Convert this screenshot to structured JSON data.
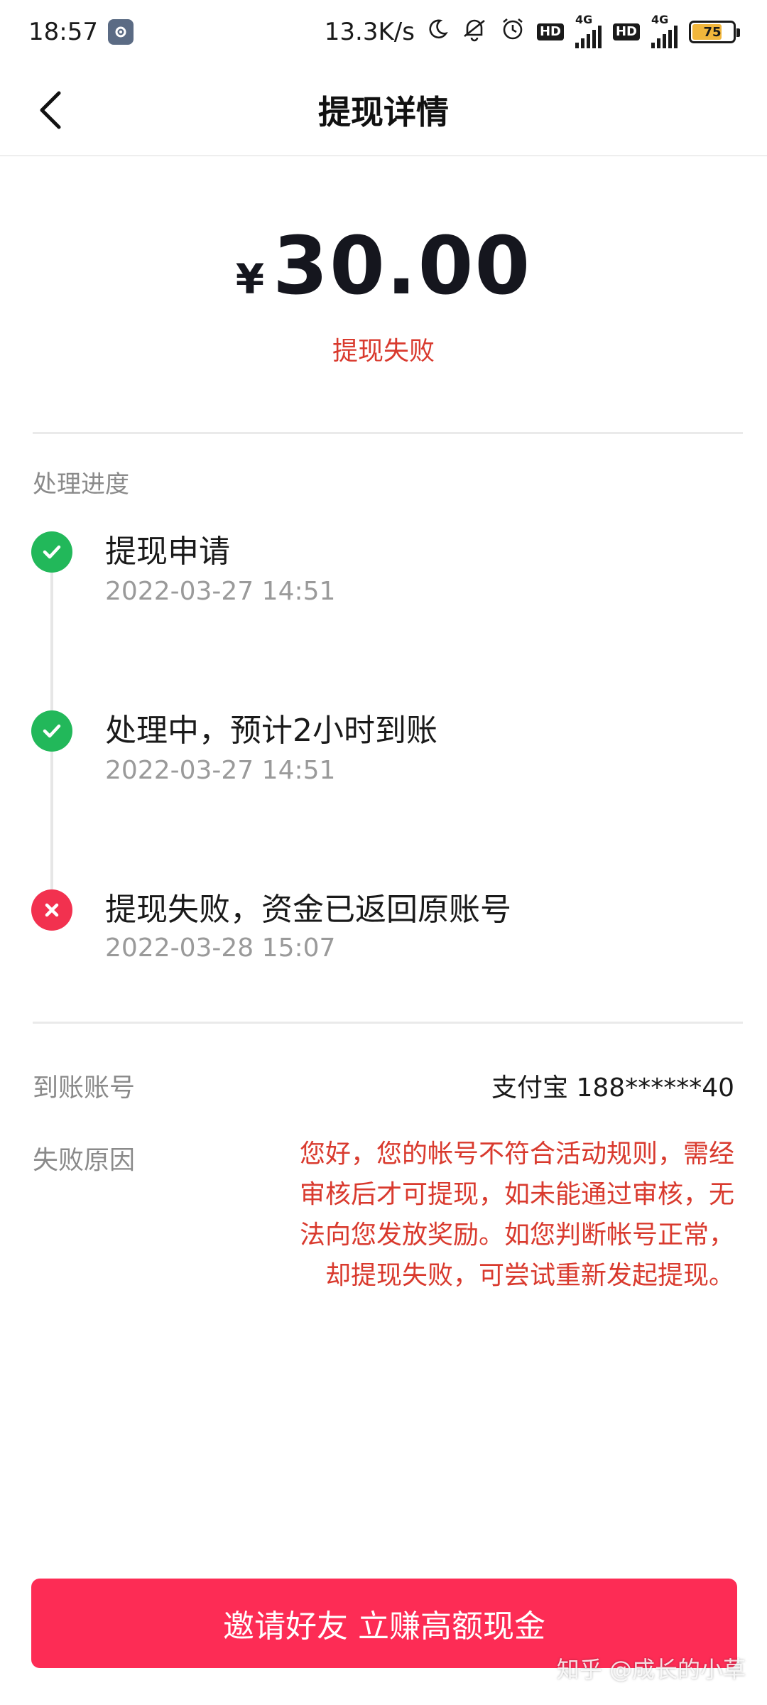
{
  "status_bar": {
    "time": "18:57",
    "net_speed": "13.3K/s",
    "network_label_1": "4G",
    "network_label_2": "4G",
    "hd_label_1": "HD",
    "hd_label_2": "HD",
    "battery": "75",
    "battery_level": 0.75
  },
  "nav": {
    "title": "提现详情"
  },
  "amount": {
    "symbol": "¥",
    "value": "30.00"
  },
  "status_text": "提现失败",
  "progress": {
    "label": "处理进度",
    "steps": [
      {
        "title": "提现申请",
        "time": "2022-03-27 14:51",
        "state": "done"
      },
      {
        "title": "处理中，预计2小时到账",
        "time": "2022-03-27 14:51",
        "state": "done"
      },
      {
        "title": "提现失败，资金已返回原账号",
        "time": "2022-03-28 15:07",
        "state": "failed"
      }
    ]
  },
  "account": {
    "label": "到账账号",
    "value": "支付宝 188******40"
  },
  "reason": {
    "label": "失败原因",
    "lines": [
      "您好，您的帐号不符合活动规则，需经",
      "审核后才可提现，如未能通过审核，无",
      "法向您发放奖励。如您判断帐号正常，",
      "却提现失败，可尝试重新发起提现。"
    ]
  },
  "cta_label": "邀请好友 立赚高额现金",
  "watermark": "知乎 @成长的小草",
  "colors": {
    "accent": "#fd2c55",
    "error": "#d93a2e",
    "success": "#22b85a",
    "fail_icon": "#f2314f"
  }
}
